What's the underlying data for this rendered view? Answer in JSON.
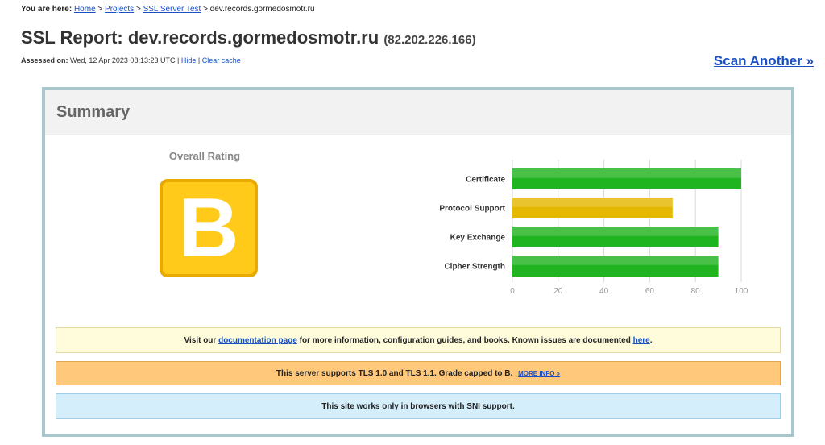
{
  "breadcrumb": {
    "lead": "You are here:",
    "items": [
      "Home",
      "Projects",
      "SSL Server Test"
    ],
    "separator": ">",
    "current": "dev.records.gormedosmotr.ru"
  },
  "report": {
    "title_prefix": "SSL Report:",
    "host": "dev.records.gormedosmotr.ru",
    "ip": "(82.202.226.166)",
    "assessed_label": "Assessed on:",
    "assessed_value": "Wed, 12 Apr 2023 08:13:23 UTC",
    "pipe": "|",
    "hide_link": "Hide",
    "clear_cache_link": "Clear cache",
    "scan_another": "Scan Another »"
  },
  "summary": {
    "heading": "Summary",
    "overall_rating_label": "Overall Rating",
    "grade": "B"
  },
  "chart_data": {
    "type": "bar",
    "orientation": "horizontal",
    "categories": [
      "Certificate",
      "Protocol Support",
      "Key Exchange",
      "Cipher Strength"
    ],
    "values": [
      100,
      70,
      90,
      90
    ],
    "colors": [
      "#21b421",
      "#e5b800",
      "#21b421",
      "#21b421"
    ],
    "xlim": [
      0,
      100
    ],
    "xticks": [
      0,
      20,
      40,
      60,
      80,
      100
    ],
    "grid": true
  },
  "notices": {
    "doc": {
      "text1": "Visit our",
      "link1": "documentation page",
      "text2": "for more information, configuration guides, and books. Known issues are documented",
      "link2": "here",
      "text3": "."
    },
    "tls": {
      "text": "This server supports TLS 1.0 and TLS 1.1. Grade capped to B.",
      "link": "MORE INFO »"
    },
    "sni": {
      "text": "This site works only in browsers with SNI support."
    }
  },
  "colors": {
    "grade_fill": "#ffca1a",
    "grade_border": "#e8a900",
    "link": "#1a4fc4",
    "box_border": "#a9c6cc"
  }
}
